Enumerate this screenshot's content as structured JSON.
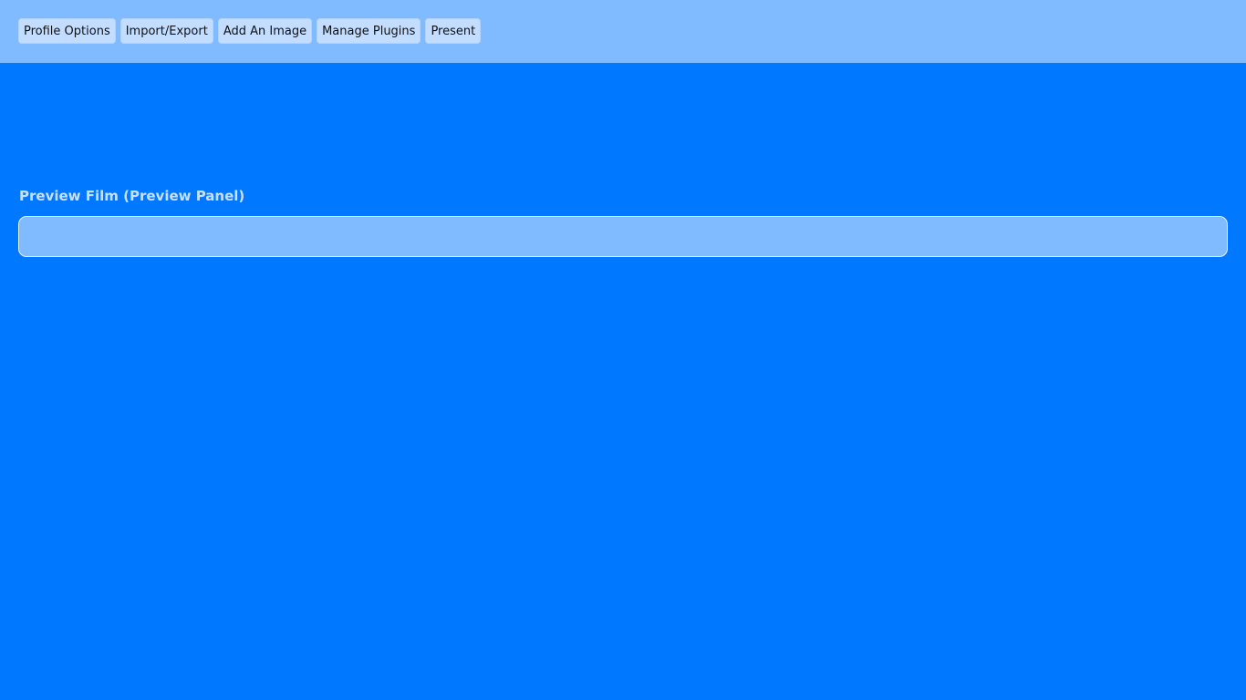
{
  "toolbar": {
    "buttons": [
      {
        "label": "Profile Options"
      },
      {
        "label": "Import/Export"
      },
      {
        "label": "Add An Image"
      },
      {
        "label": "Manage Plugins"
      },
      {
        "label": "Present"
      }
    ]
  },
  "preview": {
    "title": "Preview Film (Preview Panel)"
  },
  "colors": {
    "background": "#0078ff",
    "toolbar": "#80bbff",
    "button": "#c2ddff",
    "panel": "#80bbff"
  }
}
